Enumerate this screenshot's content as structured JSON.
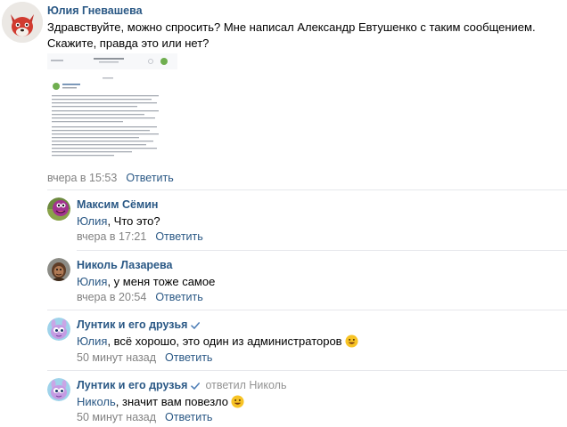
{
  "comments": [
    {
      "author": "Юлия Гневашева",
      "lines": [
        "Здравствуйте, можно спросить? Мне написал Александр Евтушенко с таким сообщением.",
        "Скажите, правда это или нет?"
      ],
      "time": "вчера в 15:53",
      "reply_label": "Ответить",
      "avatar_icon": "fox-avatar-icon"
    },
    {
      "author": "Максим Сёмин",
      "reply_to": "Юлия",
      "text": ", Что это?",
      "time": "вчера в 17:21",
      "reply_label": "Ответить",
      "avatar_icon": "purple-cartoon-avatar-icon"
    },
    {
      "author": "Николь Лазарева",
      "reply_to": "Юлия",
      "text": ", у меня тоже самое",
      "time": "вчера в 20:54",
      "reply_label": "Ответить",
      "avatar_icon": "character-avatar-icon"
    },
    {
      "author": "Лунтик и его друзья",
      "reply_to": "Юлия",
      "text": ", всё хорошо, это один из администраторов",
      "time": "50 минут назад",
      "reply_label": "Ответить",
      "avatar_icon": "luntik-avatar-icon",
      "verified": true,
      "emoji": "smile-emoji-icon"
    },
    {
      "author": "Лунтик и его друзья",
      "answered": "ответил Николь",
      "reply_to": "Николь",
      "text": ", значит вам повезло",
      "time": "50 минут назад",
      "reply_label": "Ответить",
      "avatar_icon": "luntik-avatar-icon",
      "verified": true,
      "emoji": "smile-emoji-icon"
    }
  ],
  "colors": {
    "link": "#2a5885",
    "meta": "#828282",
    "separator": "#e7e8ec",
    "verified": "#5181b8",
    "emoji": "#f7c325"
  }
}
